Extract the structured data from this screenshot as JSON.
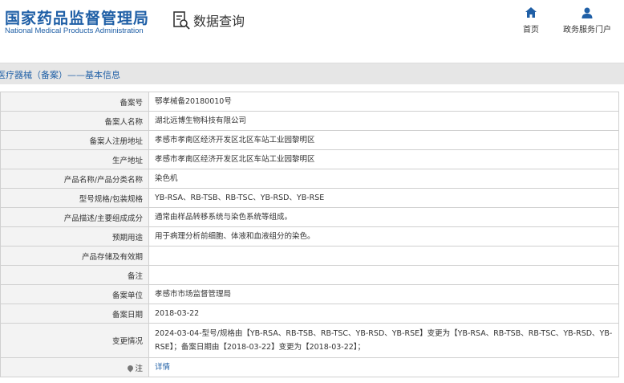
{
  "header": {
    "logo_cn": "国家药品监督管理局",
    "logo_en": "National Medical Products Administration",
    "query_label": "数据查询",
    "query_icon": "document-search-icon",
    "nav": [
      {
        "label": "首页",
        "icon": "home-icon"
      },
      {
        "label": "政务服务门户",
        "icon": "user-icon"
      }
    ]
  },
  "section": {
    "title": "医疗器械（备案）——基本信息"
  },
  "rows": [
    {
      "label": "备案号",
      "value": "鄂孝械备20180010号"
    },
    {
      "label": "备案人名称",
      "value": "湖北远博生物科技有限公司"
    },
    {
      "label": "备案人注册地址",
      "value": "孝感市孝南区经济开发区北区车站工业园黎明区"
    },
    {
      "label": "生产地址",
      "value": "孝感市孝南区经济开发区北区车站工业园黎明区"
    },
    {
      "label": "产品名称/产品分类名称",
      "value": "染色机"
    },
    {
      "label": "型号规格/包装规格",
      "value": "YB-RSA、RB-TSB、RB-TSC、YB-RSD、YB-RSE"
    },
    {
      "label": "产品描述/主要组成成分",
      "value": "通常由样品转移系统与染色系统等组成。"
    },
    {
      "label": "预期用途",
      "value": "用于病理分析前细胞、体液和血液组分的染色。"
    },
    {
      "label": "产品存储及有效期",
      "value": ""
    },
    {
      "label": "备注",
      "value": ""
    },
    {
      "label": "备案单位",
      "value": "孝感市市场监督管理局"
    },
    {
      "label": "备案日期",
      "value": "2018-03-22"
    },
    {
      "label": "变更情况",
      "value": "2024-03-04-型号/规格由【YB-RSA、RB-TSB、RB-TSC、YB-RSD、YB-RSE】变更为【YB-RSA、RB-TSB、RB-TSC、YB-RSD、YB-RSE】；备案日期由【2018-03-22】变更为【2018-03-22】；"
    },
    {
      "label": "注",
      "value": "详情"
    }
  ]
}
